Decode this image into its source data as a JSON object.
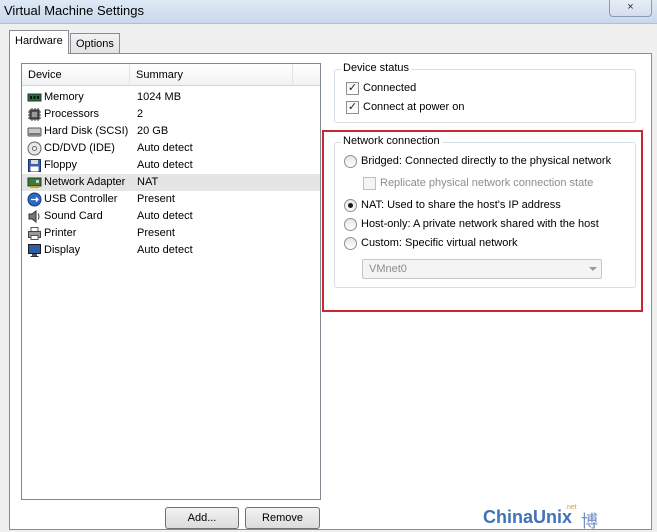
{
  "window": {
    "title": "Virtual Machine Settings",
    "close_glyph": "×"
  },
  "tabs": [
    {
      "label": "Hardware",
      "active": true
    },
    {
      "label": "Options",
      "active": false
    }
  ],
  "device_list": {
    "headers": {
      "device": "Device",
      "summary": "Summary"
    },
    "rows": [
      {
        "icon": "memory-icon",
        "device": "Memory",
        "summary": "1024 MB",
        "selected": false
      },
      {
        "icon": "processor-icon",
        "device": "Processors",
        "summary": "2",
        "selected": false
      },
      {
        "icon": "hard-disk-icon",
        "device": "Hard Disk (SCSI)",
        "summary": "20 GB",
        "selected": false
      },
      {
        "icon": "cd-dvd-icon",
        "device": "CD/DVD (IDE)",
        "summary": "Auto detect",
        "selected": false
      },
      {
        "icon": "floppy-icon",
        "device": "Floppy",
        "summary": "Auto detect",
        "selected": false
      },
      {
        "icon": "network-adapter-icon",
        "device": "Network Adapter",
        "summary": "NAT",
        "selected": true
      },
      {
        "icon": "usb-icon",
        "device": "USB Controller",
        "summary": "Present",
        "selected": false
      },
      {
        "icon": "sound-card-icon",
        "device": "Sound Card",
        "summary": "Auto detect",
        "selected": false
      },
      {
        "icon": "printer-icon",
        "device": "Printer",
        "summary": "Present",
        "selected": false
      },
      {
        "icon": "display-icon",
        "device": "Display",
        "summary": "Auto detect",
        "selected": false
      }
    ]
  },
  "buttons": {
    "add": "Add...",
    "remove": "Remove"
  },
  "device_status": {
    "title": "Device status",
    "connected": {
      "label": "Connected",
      "checked": true
    },
    "connect_at_power_on": {
      "label": "Connect at power on",
      "checked": true
    }
  },
  "network_connection": {
    "title": "Network connection",
    "bridged": {
      "label": "Bridged: Connected directly to the physical network",
      "selected": false
    },
    "replicate": {
      "label": "Replicate physical network connection state",
      "checked": false,
      "enabled": false
    },
    "nat": {
      "label": "NAT: Used to share the host's IP address",
      "selected": true
    },
    "host_only": {
      "label": "Host-only: A private network shared with the host",
      "selected": false
    },
    "custom": {
      "label": "Custom: Specific virtual network",
      "selected": false
    },
    "vmnet_select": {
      "value": "VMnet0",
      "enabled": false
    }
  },
  "watermark": {
    "brand": "ChinaUnix",
    "tld": ".net",
    "cn": "博客"
  },
  "colors": {
    "highlight": "#c8282f",
    "selected_row": "#e5e5e5",
    "watermark": "#3f72b6"
  }
}
